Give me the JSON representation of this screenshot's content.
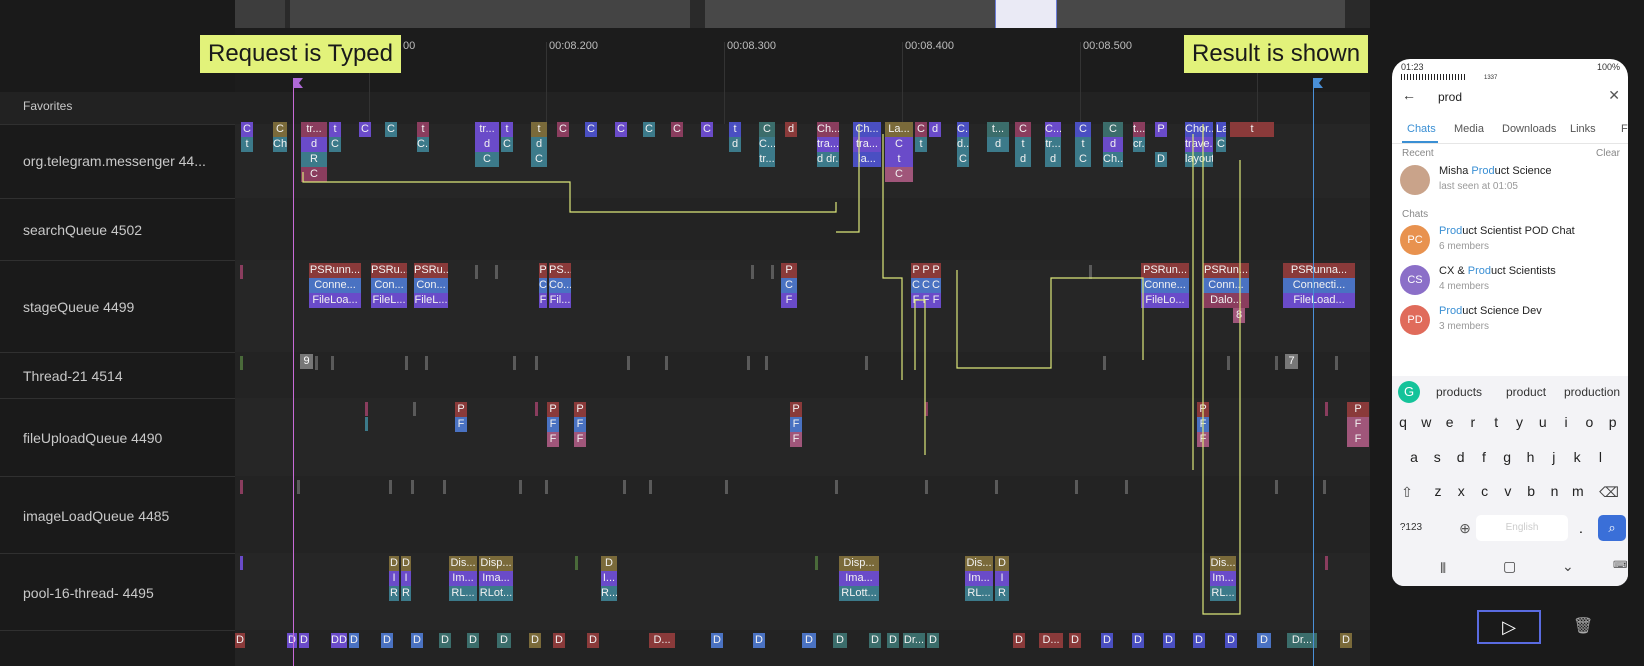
{
  "favorites": "Favorites",
  "threads": [
    {
      "label": "org.telegram.messenger 44..."
    },
    {
      "label": "searchQueue 4502"
    },
    {
      "label": "stageQueue 4499"
    },
    {
      "label": "Thread-21 4514"
    },
    {
      "label": "fileUploadQueue 4490"
    },
    {
      "label": "imageLoadQueue 4485"
    },
    {
      "label": "pool-16-thread- 4495"
    }
  ],
  "ruler": {
    "ticks": [
      "00",
      "00:08.200",
      "00:08.300",
      "00:08.400",
      "00:08.500"
    ]
  },
  "callouts": {
    "request": "Request is Typed",
    "result": "Result is shown"
  },
  "main_thread_blocks": [
    "C",
    "t",
    "C",
    "Ch...",
    "tr...",
    "d",
    "R",
    "C",
    "t",
    "C",
    "C",
    "C",
    "t",
    "C...",
    "tr...",
    "d",
    "C",
    "t",
    "C",
    "t",
    "d",
    "C",
    "C",
    "C",
    "C",
    "C",
    "C",
    "C",
    "t",
    "d",
    "C",
    "C...",
    "tr...",
    "d",
    "Ch...",
    "tra...",
    "d dr...",
    "Ch...",
    "tra...",
    "la...",
    "La...",
    "C",
    "t",
    "C",
    "C",
    "t",
    "d",
    "C...",
    "d...",
    "C",
    "t...",
    "d",
    "C",
    "t",
    "d",
    "C...",
    "tr...",
    "d",
    "C",
    "t",
    "C",
    "C",
    "d",
    "Ch...",
    "t...",
    "cr...",
    "P",
    "D",
    "Chor...",
    "trave...",
    "layout",
    "Laun...",
    "C",
    "t"
  ],
  "stage_blocks": [
    "PSRunn...",
    "Conne...",
    "FileLoa...",
    "PSRu...",
    "Con...",
    "FileL...",
    "PSRu...",
    "Con...",
    "FileL...",
    "P",
    "C",
    "F",
    "PS...",
    "Co...",
    "Fil...",
    "P",
    "C",
    "F",
    "P",
    "P",
    "P",
    "C",
    "C",
    "C",
    "F",
    "F",
    "F",
    "PSRun...",
    "Conne...",
    "FileLo...",
    "PSRun...",
    "Conn...",
    "Dalo...",
    "8",
    "PSRunna...",
    "Connecti...",
    "FileLoad..."
  ],
  "thread21_badges": [
    "9",
    "7"
  ],
  "upload_blocks": [
    "P",
    "F",
    "P",
    "F",
    "F",
    "P",
    "F",
    "F",
    "P",
    "F",
    "F",
    "P",
    "F",
    "F",
    "P",
    "F",
    "F"
  ],
  "pool_blocks": [
    "D",
    "D",
    "I",
    "I",
    "R",
    "R",
    "Dis...",
    "Disp...",
    "Im...",
    "Ima...",
    "RL...",
    "RLot...",
    "D",
    "I...",
    "R...",
    "Disp...",
    "Ima...",
    "RLott...",
    "Dis...",
    "D",
    "Im...",
    "I",
    "RL...",
    "R",
    "Dis...",
    "Im...",
    "RL..."
  ],
  "bottom_blocks": [
    "D",
    "D",
    "D",
    "DD",
    "D",
    "D",
    "D",
    "D",
    "D",
    "D",
    "D",
    "D",
    "D",
    "D...",
    "D",
    "D",
    "D",
    "D",
    "D",
    "D",
    "Dr...",
    "D",
    "D",
    "D...",
    "D",
    "D",
    "D",
    "D",
    "D",
    "D",
    "D",
    "Dr...",
    "D"
  ],
  "phone": {
    "time": "01:23",
    "battery": "100%",
    "signal_text": "1337",
    "search_value": "prod",
    "tabs": [
      "Chats",
      "Media",
      "Downloads",
      "Links",
      "F"
    ],
    "recent_header": "Recent",
    "clear_label": "Clear",
    "recent_contact": {
      "name_pre": "Misha ",
      "name_hl": "Prod",
      "name_post": "uct Science",
      "status": "last seen at 01:05"
    },
    "chats_header": "Chats",
    "chats": [
      {
        "initials": "PC",
        "color": "#e8924f",
        "title_hl": "Prod",
        "title_post": "uct Scientist POD Chat",
        "sub": "6 members"
      },
      {
        "initials": "CS",
        "color": "#8b6fc8",
        "title_pre": "CX & ",
        "title_hl": "Prod",
        "title_post": "uct Scientists",
        "sub": "4 members"
      },
      {
        "initials": "PD",
        "color": "#e06b5b",
        "title_hl": "Prod",
        "title_post": "uct Science Dev",
        "sub": "3 members"
      }
    ],
    "suggestions": [
      "products",
      "product",
      "production"
    ],
    "keys_row1": [
      "q",
      "w",
      "e",
      "r",
      "t",
      "y",
      "u",
      "i",
      "o",
      "p"
    ],
    "keys_row2": [
      "a",
      "s",
      "d",
      "f",
      "g",
      "h",
      "j",
      "k",
      "l"
    ],
    "keys_row3": [
      "z",
      "x",
      "c",
      "v",
      "b",
      "n",
      "m"
    ],
    "key_123": "?123",
    "space_label": "English",
    "period": "."
  }
}
